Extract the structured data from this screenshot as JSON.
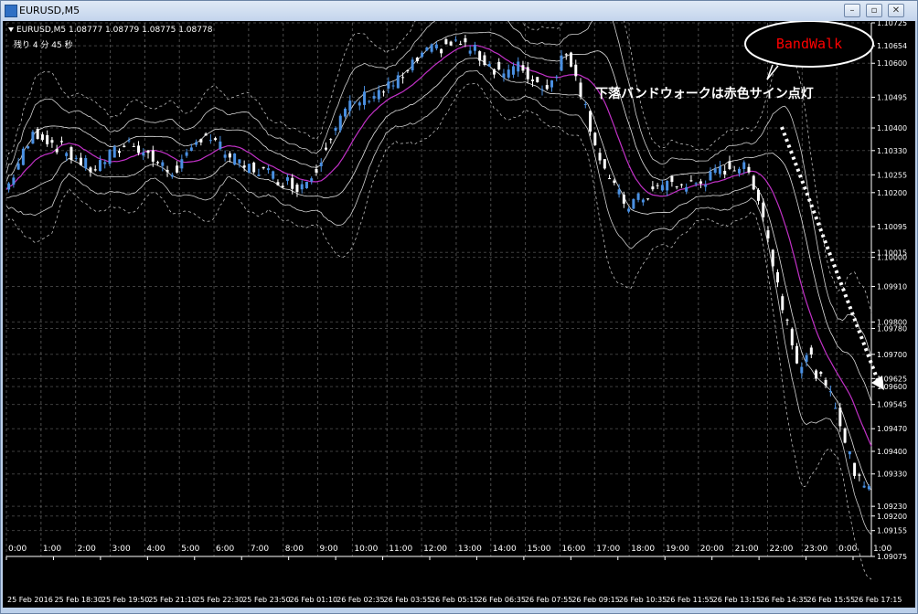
{
  "window": {
    "title": "EURUSD,M5",
    "buttons": [
      "minimize",
      "maximize",
      "close"
    ]
  },
  "header": {
    "symbol_line": "EURUSD,M5  1.08777 1.08779 1.08775 1.08778",
    "remaining": "残り  4  分  45  秒"
  },
  "annotation": {
    "bubble_text": "BandWalk",
    "caption": "下落バンドウォークは赤色サイン点灯",
    "colors": {
      "bubble_text": "#ff0000",
      "caption": "#ffffff"
    }
  },
  "chart_data": {
    "type": "candlestick",
    "instrument": "EURUSD",
    "timeframe": "M5",
    "grid": true,
    "price_scale": {
      "ticks": [
        "1.10725",
        "1.10654",
        "1.10600",
        "1.10495",
        "1.10400",
        "1.10330",
        "1.10255",
        "1.10200",
        "1.10095",
        "1.10015",
        "1.10000",
        "1.09910",
        "1.09800",
        "1.09780",
        "1.09700",
        "1.09625",
        "1.09600",
        "1.09545",
        "1.09470",
        "1.09400",
        "1.09330",
        "1.09230",
        "1.09200",
        "1.09155",
        "1.09075"
      ],
      "range": [
        1.09075,
        1.10725
      ]
    },
    "top_time_axis": [
      "0:00",
      "1:00",
      "2:00",
      "3:00",
      "4:00",
      "5:00",
      "6:00",
      "7:00",
      "8:00",
      "9:00",
      "10:00",
      "11:00",
      "12:00",
      "13:00",
      "14:00",
      "15:00",
      "16:00",
      "17:00",
      "18:00",
      "19:00",
      "20:00",
      "21:00",
      "22:00",
      "23:00",
      "0:00",
      "1:00"
    ],
    "bottom_time_axis": [
      "25 Feb 2016",
      "25 Feb 18:30",
      "25 Feb 19:50",
      "25 Feb 21:10",
      "25 Feb 22:30",
      "25 Feb 23:50",
      "26 Feb 01:10",
      "26 Feb 02:35",
      "26 Feb 03:55",
      "26 Feb 05:15",
      "26 Feb 06:35",
      "26 Feb 07:55",
      "26 Feb 09:15",
      "26 Feb 10:35",
      "26 Feb 11:55",
      "26 Feb 13:15",
      "26 Feb 14:35",
      "26 Feb 15:55",
      "26 Feb 17:15"
    ],
    "price_path": [
      [
        0,
        1.1021
      ],
      [
        5,
        1.1029
      ],
      [
        12,
        1.1039
      ],
      [
        20,
        1.1035
      ],
      [
        28,
        1.1031
      ],
      [
        36,
        1.1027
      ],
      [
        44,
        1.1032
      ],
      [
        52,
        1.1036
      ],
      [
        60,
        1.1031
      ],
      [
        68,
        1.1026
      ],
      [
        76,
        1.1031
      ],
      [
        82,
        1.1039
      ],
      [
        90,
        1.1033
      ],
      [
        98,
        1.1028
      ],
      [
        106,
        1.1027
      ],
      [
        114,
        1.1024
      ],
      [
        122,
        1.1022
      ],
      [
        128,
        1.1026
      ],
      [
        134,
        1.1037
      ],
      [
        142,
        1.1046
      ],
      [
        150,
        1.105
      ],
      [
        158,
        1.1052
      ],
      [
        166,
        1.1056
      ],
      [
        172,
        1.1062
      ],
      [
        178,
        1.1064
      ],
      [
        184,
        1.1066
      ],
      [
        190,
        1.1066
      ],
      [
        196,
        1.1063
      ],
      [
        202,
        1.1059
      ],
      [
        208,
        1.1057
      ],
      [
        214,
        1.1059
      ],
      [
        220,
        1.1054
      ],
      [
        226,
        1.1053
      ],
      [
        232,
        1.1063
      ],
      [
        236,
        1.106
      ],
      [
        240,
        1.1049
      ],
      [
        246,
        1.1033
      ],
      [
        252,
        1.1022
      ],
      [
        258,
        1.1016
      ],
      [
        264,
        1.1018
      ],
      [
        270,
        1.1021
      ],
      [
        276,
        1.1023
      ],
      [
        282,
        1.1022
      ],
      [
        288,
        1.1023
      ],
      [
        294,
        1.1025
      ],
      [
        300,
        1.1028
      ],
      [
        306,
        1.1028
      ],
      [
        310,
        1.1025
      ],
      [
        314,
        1.1017
      ],
      [
        318,
        1.1002
      ],
      [
        322,
        1.0988
      ],
      [
        326,
        1.0978
      ],
      [
        330,
        1.0966
      ],
      [
        334,
        1.097
      ],
      [
        338,
        1.0963
      ],
      [
        342,
        1.0958
      ],
      [
        346,
        1.0953
      ],
      [
        350,
        1.094
      ],
      [
        354,
        1.0932
      ],
      [
        358,
        1.093
      ]
    ]
  }
}
